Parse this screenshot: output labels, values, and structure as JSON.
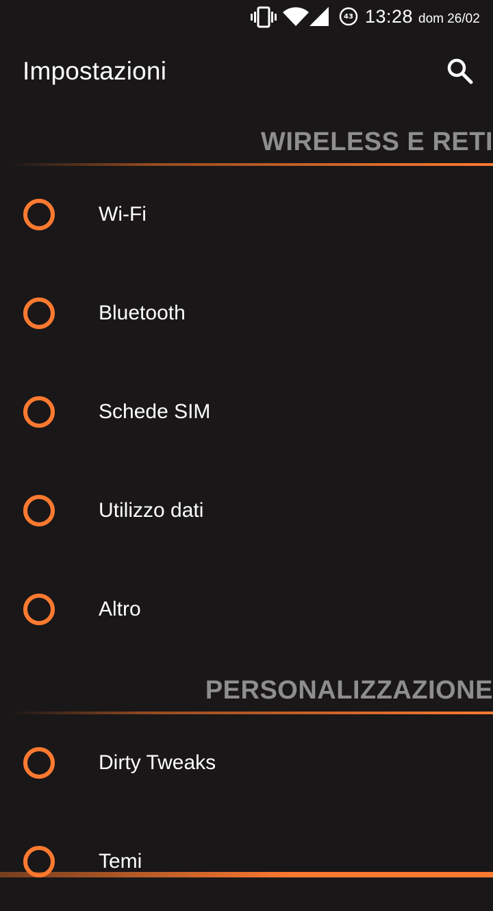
{
  "status_bar": {
    "time": "13:28",
    "date": "dom 26/02",
    "battery_level": "43",
    "icons": [
      "vibrate-icon",
      "wifi-icon",
      "signal-icon",
      "battery-icon"
    ]
  },
  "app_bar": {
    "title": "Impostazioni",
    "search_icon": "search-icon"
  },
  "sections": [
    {
      "title": "WIRELESS E RETI",
      "items": [
        {
          "label": "Wi-Fi",
          "icon": "ring-icon"
        },
        {
          "label": "Bluetooth",
          "icon": "ring-icon"
        },
        {
          "label": "Schede SIM",
          "icon": "ring-icon"
        },
        {
          "label": "Utilizzo dati",
          "icon": "ring-icon"
        },
        {
          "label": "Altro",
          "icon": "ring-icon"
        }
      ]
    },
    {
      "title": "PERSONALIZZAZIONE",
      "items": [
        {
          "label": "Dirty Tweaks",
          "icon": "ring-icon"
        },
        {
          "label": "Temi",
          "icon": "ring-icon"
        }
      ]
    }
  ],
  "colors": {
    "background": "#1a1718",
    "accent": "#ff7a30",
    "section_text": "#8f8e8f",
    "text": "#ffffff"
  }
}
